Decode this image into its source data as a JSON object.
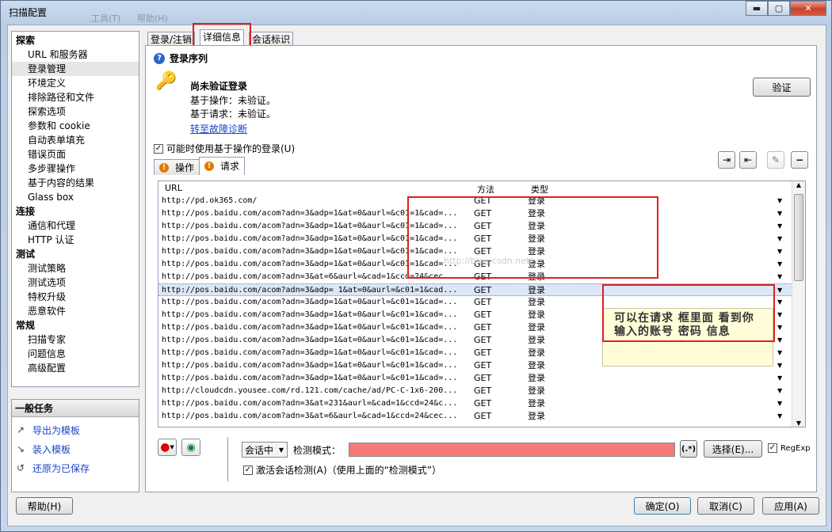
{
  "window": {
    "title": "扫描配置",
    "ghost_menu": [
      "工具(T)",
      "帮助(H)"
    ],
    "minimize": "▬",
    "maximize": "▢",
    "close": "✕"
  },
  "nav": [
    {
      "type": "group",
      "label": "探索"
    },
    {
      "type": "item",
      "label": "URL 和服务器"
    },
    {
      "type": "item",
      "label": "登录管理",
      "selected": true
    },
    {
      "type": "item",
      "label": "环境定义"
    },
    {
      "type": "item",
      "label": "排除路径和文件"
    },
    {
      "type": "item",
      "label": "探索选项"
    },
    {
      "type": "item",
      "label": "参数和 cookie"
    },
    {
      "type": "item",
      "label": "自动表单填充"
    },
    {
      "type": "item",
      "label": "错误页面"
    },
    {
      "type": "item",
      "label": "多步骤操作"
    },
    {
      "type": "item",
      "label": "基于内容的结果"
    },
    {
      "type": "item",
      "label": "Glass box"
    },
    {
      "type": "group",
      "label": "连接"
    },
    {
      "type": "item",
      "label": "通信和代理"
    },
    {
      "type": "item",
      "label": "HTTP 认证"
    },
    {
      "type": "group",
      "label": "测试"
    },
    {
      "type": "item",
      "label": "测试策略"
    },
    {
      "type": "item",
      "label": "测试选项"
    },
    {
      "type": "item",
      "label": "特权升级"
    },
    {
      "type": "item",
      "label": "恶意软件"
    },
    {
      "type": "group",
      "label": "常规"
    },
    {
      "type": "item",
      "label": "扫描专家"
    },
    {
      "type": "item",
      "label": "问题信息"
    },
    {
      "type": "item",
      "label": "高级配置"
    }
  ],
  "tasks": {
    "header": "一般任务",
    "items": [
      {
        "label": "导出为模板",
        "icon": "export-icon"
      },
      {
        "label": "装入模板",
        "icon": "import-icon"
      },
      {
        "label": "还原为已保存",
        "icon": "restore-icon"
      }
    ]
  },
  "tabs": [
    {
      "label": "登录/注销"
    },
    {
      "label": "详细信息",
      "active": true
    },
    {
      "label": "会话标识"
    }
  ],
  "section_title": "登录序列",
  "status": {
    "title": "尚未验证登录",
    "line1": "基于操作：未验证。",
    "line2": "基于请求：未验证。",
    "link": "转至故障诊断",
    "verify_button": "验证"
  },
  "use_action_login": "可能时使用基于操作的登录(U)",
  "subtabs": [
    {
      "label": "操作"
    },
    {
      "label": "请求",
      "active": true
    }
  ],
  "grid": {
    "headers": {
      "url": "URL",
      "method": "方法",
      "type": "类型"
    },
    "rows": [
      {
        "url": "http://pd.ok365.com/",
        "method": "GET",
        "type": "登录"
      },
      {
        "url": "http://pos.baidu.com/acom?adn=3&adp=1&at=0&aurl=&c01=1&cad=...",
        "method": "GET",
        "type": "登录"
      },
      {
        "url": "http://pos.baidu.com/acom?adn=3&adp=1&at=0&aurl=&c01=1&cad=...",
        "method": "GET",
        "type": "登录"
      },
      {
        "url": "http://pos.baidu.com/acom?adn=3&adp=1&at=0&aurl=&c01=1&cad=...",
        "method": "GET",
        "type": "登录"
      },
      {
        "url": "http://pos.baidu.com/acom?adn=3&adp=1&at=0&aurl=&c01=1&cad=...",
        "method": "GET",
        "type": "登录"
      },
      {
        "url": "http://pos.baidu.com/acom?adn=3&adp=1&at=0&aurl=&c01=1&cad=...",
        "method": "GET",
        "type": "登录"
      },
      {
        "url": "http://pos.baidu.com/acom?adn=3&at=6&aurl=&cad=1&ccd=24&cec...",
        "method": "GET",
        "type": "登录"
      },
      {
        "url": "http://pos.baidu.com/acom?adn=3&adp= 1&at=0&aurl=&c01=1&cad...",
        "method": "GET",
        "type": "登录",
        "selected": true
      },
      {
        "url": "http://pos.baidu.com/acom?adn=3&adp=1&at=0&aurl=&c01=1&cad=...",
        "method": "GET",
        "type": "登录"
      },
      {
        "url": "http://pos.baidu.com/acom?adn=3&adp=1&at=0&aurl=&c01=1&cad=...",
        "method": "GET",
        "type": "登录"
      },
      {
        "url": "http://pos.baidu.com/acom?adn=3&adp=1&at=0&aurl=&c01=1&cad=...",
        "method": "GET",
        "type": "登录"
      },
      {
        "url": "http://pos.baidu.com/acom?adn=3&adp=1&at=0&aurl=&c01=1&cad=...",
        "method": "GET",
        "type": "登录"
      },
      {
        "url": "http://pos.baidu.com/acom?adn=3&adp=1&at=0&aurl=&c01=1&cad=...",
        "method": "GET",
        "type": "登录"
      },
      {
        "url": "http://pos.baidu.com/acom?adn=3&adp=1&at=0&aurl=&c01=1&cad=...",
        "method": "GET",
        "type": "登录"
      },
      {
        "url": "http://pos.baidu.com/acom?adn=3&adp=1&at=0&aurl=&c01=1&cad=...",
        "method": "GET",
        "type": "登录"
      },
      {
        "url": "http://cloudcdn.yousee.com/rd.121.com/cache/ad/PC-C-1x6-200...",
        "method": "GET",
        "type": "登录"
      },
      {
        "url": "http://pos.baidu.com/acom?adn=3&at=231&aurl=&cad=1&ccd=24&c...",
        "method": "GET",
        "type": "登录"
      },
      {
        "url": "http://pos.baidu.com/acom?adn=3&at=6&aurl=&cad=1&ccd=24&cec...",
        "method": "GET",
        "type": "登录"
      }
    ]
  },
  "annotation": "可以在请求 框里面 看到你输入的账号 密码 信息",
  "watermark": "http://blog.csdn.net/",
  "bottom": {
    "session_select": "会话中",
    "detect_label": "检测模式：",
    "regex_btn": "(.*)",
    "choose_btn": "选择(E)...",
    "regexp_label": "RegExp",
    "activate_label": "激活会话检测(A)（使用上面的“检测模式”）"
  },
  "footer": {
    "help": "帮助(H)",
    "ok": "确定(O)",
    "cancel": "取消(C)",
    "apply": "应用(A)"
  }
}
